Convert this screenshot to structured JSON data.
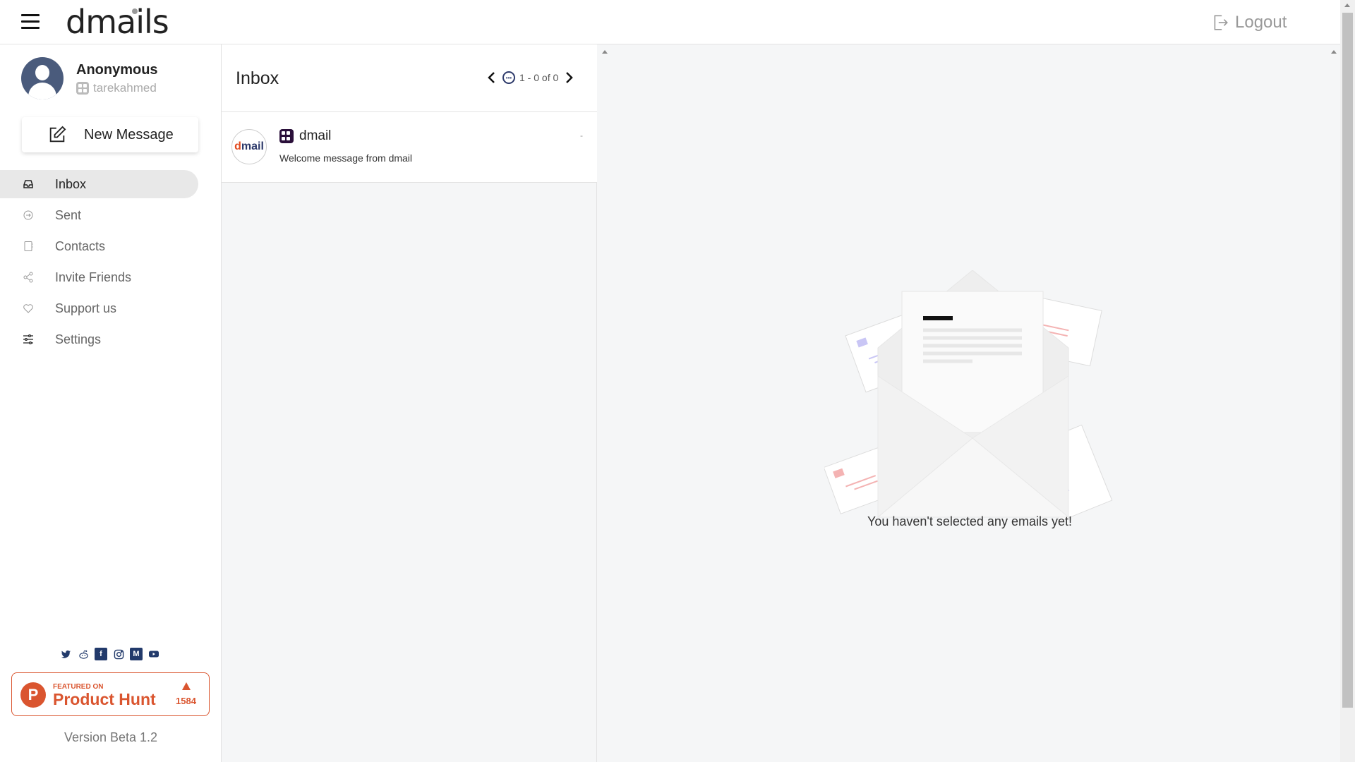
{
  "header": {
    "logo": "dmails",
    "logout_label": "Logout"
  },
  "profile": {
    "name": "Anonymous",
    "handle": "tarekahmed"
  },
  "compose": {
    "label": "New Message"
  },
  "nav": {
    "items": [
      {
        "label": "Inbox",
        "icon": "inbox-icon",
        "active": true
      },
      {
        "label": "Sent",
        "icon": "sent-icon"
      },
      {
        "label": "Contacts",
        "icon": "contacts-icon"
      },
      {
        "label": "Invite Friends",
        "icon": "share-icon"
      },
      {
        "label": "Support us",
        "icon": "heart-icon"
      },
      {
        "label": "Settings",
        "icon": "sliders-icon"
      }
    ]
  },
  "socials": [
    "twitter-icon",
    "reddit-icon",
    "facebook-icon",
    "instagram-icon",
    "medium-icon",
    "youtube-icon"
  ],
  "product_hunt": {
    "featured": "FEATURED ON",
    "name": "Product Hunt",
    "letter": "P",
    "count": "1584"
  },
  "version": "Version Beta 1.2",
  "list": {
    "title": "Inbox",
    "pager": "1 - 0 of 0",
    "emails": [
      {
        "sender": "dmail",
        "subject": "Welcome message from dmail",
        "date": "-",
        "avatar_text_1": "d",
        "avatar_text_2": "mail"
      }
    ]
  },
  "reader": {
    "empty_text": "You haven't selected any emails yet!"
  },
  "colors": {
    "accent": "#da552f",
    "brand_dark": "#2a0f3a",
    "active_bg": "#e8e8e8"
  }
}
